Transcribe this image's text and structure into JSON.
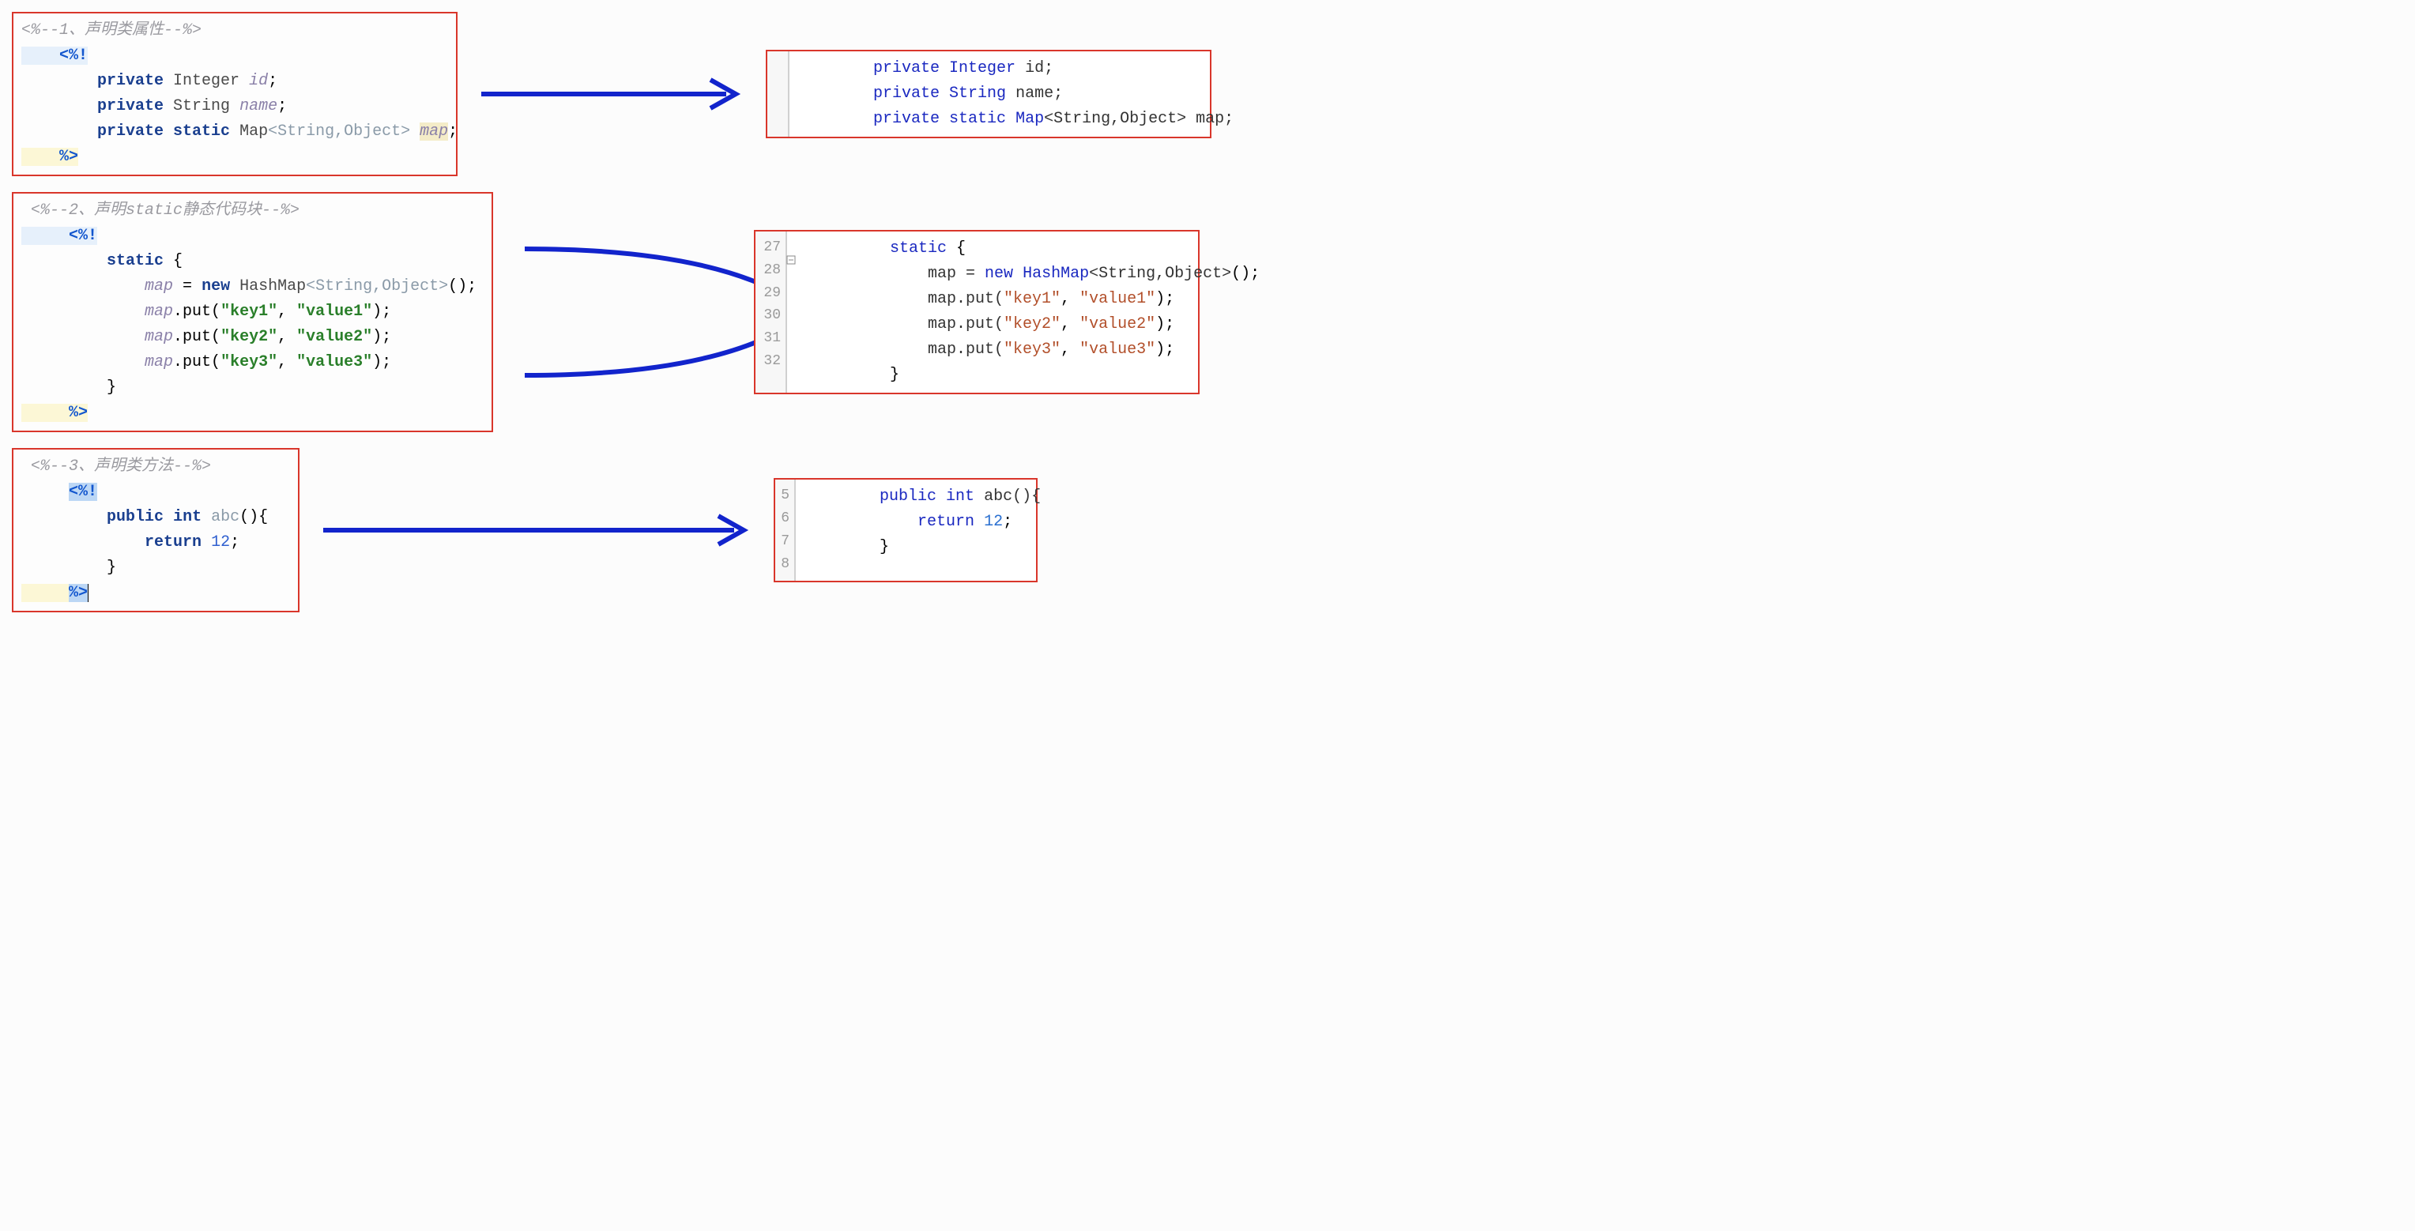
{
  "colors": {
    "border": "#d9362b",
    "arrow": "#1224cc"
  },
  "blocks": {
    "b1": {
      "comment": "<%--1、声明类属性--%>",
      "open": "<%!",
      "lines": {
        "l1_kw": "private",
        "l1_type": "Integer",
        "l1_name": "id",
        "l2_kw": "private",
        "l2_type": "String",
        "l2_name": "name",
        "l3_kw1": "private",
        "l3_kw2": "static",
        "l3_type": "Map",
        "l3_gen": "<String,Object>",
        "l3_name": "map"
      },
      "close": "%>"
    },
    "r1": {
      "l1_kw": "private",
      "l1_type": "Integer",
      "l1_name": "id;",
      "l2_kw": "private",
      "l2_type": "String",
      "l2_name": "name;",
      "l3_kw1": "private",
      "l3_kw2": "static",
      "l3_type": "Map",
      "l3_gen": "<String,Object>",
      "l3_name": "map;"
    },
    "b2": {
      "comment": "<%--2、声明static静态代码块--%>",
      "open": "<%!",
      "l_static": "static",
      "l_map": "map",
      "l_eq": " = ",
      "l_new": "new",
      "l_hmap": "HashMap",
      "l_gen": "<String,Object>",
      "l_tail": "();",
      "put1_a": "map",
      "put1_b": ".put(",
      "put1_k": "\"key1\"",
      "put1_c": ", ",
      "put1_v": "\"value1\"",
      "put1_end": ");",
      "put2_k": "\"key2\"",
      "put2_v": "\"value2\"",
      "put3_k": "\"key3\"",
      "put3_v": "\"value3\"",
      "close": "%>"
    },
    "r2": {
      "gutter": [
        "27",
        "28",
        "29",
        "30",
        "31",
        "32"
      ],
      "l_static": "static",
      "map_line": "map = ",
      "l_new": "new",
      "l_hmap": "HashMap",
      "l_gen": "<String,Object>",
      "l_tail": "();",
      "p1_pre": "map.put(",
      "p1_k": "\"key1\"",
      "p1_c": ", ",
      "p1_v": "\"value1\"",
      "p1_end": ");",
      "p2_k": "\"key2\"",
      "p2_v": "\"value2\"",
      "p3_k": "\"key3\"",
      "p3_v": "\"value3\""
    },
    "b3": {
      "comment": "<%--3、声明类方法--%>",
      "open": "<%!",
      "kw_public": "public",
      "kw_int": "int",
      "method": "abc",
      "paren": "(){",
      "kw_return": "return",
      "val": "12",
      "close": "%>"
    },
    "r3": {
      "gutter": [
        "5",
        "6",
        "7",
        "8"
      ],
      "kw_public": "public",
      "kw_int": "int",
      "method": "abc(){",
      "kw_return": "return",
      "val": "12"
    }
  }
}
